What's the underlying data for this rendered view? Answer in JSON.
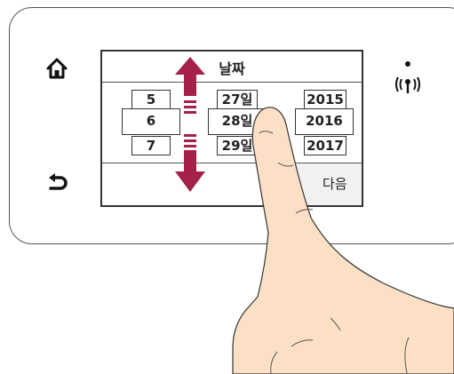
{
  "screen": {
    "title": "날짜",
    "next_label": "다음",
    "month_values": [
      "5",
      "6",
      "7"
    ],
    "day_values": [
      "27일",
      "28일",
      "29일"
    ],
    "year_values": [
      "2015",
      "2016",
      "2017"
    ]
  },
  "colors": {
    "scroll_arrow": "#a5214a",
    "panel_border": "#555555",
    "skin": "#fbe0c5",
    "next_button_bg": "#f1f1f1"
  },
  "icons": [
    "home-icon",
    "back-icon",
    "wireless-icon",
    "scroll-arrow-icon",
    "finger-illustration"
  ]
}
